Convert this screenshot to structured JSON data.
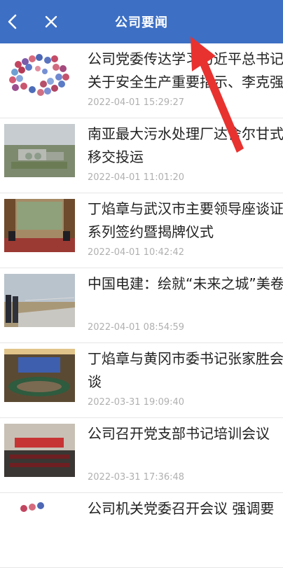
{
  "header": {
    "title": "公司要闻",
    "back_icon": "chevron-left-icon",
    "close_icon": "close-icon",
    "color": "#3d6fc4"
  },
  "news": [
    {
      "title": "公司党委传达学习习近平总书记关于安全生产重要指示、李克强",
      "time": "2022-04-01 15:29:27"
    },
    {
      "title": "南亚最大污水处理厂达舍尔甘式移交投运",
      "time": "2022-04-01 11:01:20"
    },
    {
      "title": "丁焰章与武汉市主要领导座谈证系列签约暨揭牌仪式",
      "time": "2022-04-01 10:42:42"
    },
    {
      "title": "中国电建：绘就“未来之城”美卷",
      "time": "2022-04-01 08:54:59"
    },
    {
      "title": "丁焰章与黄冈市委书记张家胜会谈",
      "time": "2022-03-31 19:09:40"
    },
    {
      "title": "公司召开党支部书记培训会议",
      "time": "2022-03-31 17:36:48"
    },
    {
      "title": "公司机关党委召开会议 强调要",
      "time": ""
    }
  ]
}
